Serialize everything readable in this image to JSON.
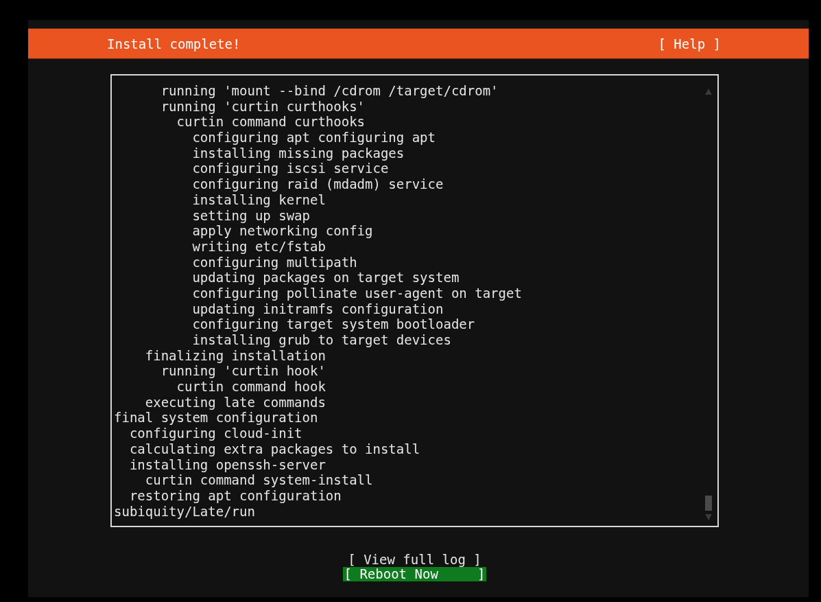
{
  "header": {
    "title": "Install complete!",
    "help": "[ Help ]"
  },
  "log": {
    "lines": [
      "      running 'mount --bind /cdrom /target/cdrom'",
      "      running 'curtin curthooks'",
      "        curtin command curthooks",
      "          configuring apt configuring apt",
      "          installing missing packages",
      "          configuring iscsi service",
      "          configuring raid (mdadm) service",
      "          installing kernel",
      "          setting up swap",
      "          apply networking config",
      "          writing etc/fstab",
      "          configuring multipath",
      "          updating packages on target system",
      "          configuring pollinate user-agent on target",
      "          updating initramfs configuration",
      "          configuring target system bootloader",
      "          installing grub to target devices",
      "    finalizing installation",
      "      running 'curtin hook'",
      "        curtin command hook",
      "    executing late commands",
      "final system configuration",
      "  configuring cloud-init",
      "  calculating extra packages to install",
      "  installing openssh-server",
      "    curtin command system-install",
      "  restoring apt configuration",
      "subiquity/Late/run"
    ]
  },
  "buttons": [
    {
      "label": "[ View full log ]",
      "selected": false
    },
    {
      "label": "[ Reboot Now     ]",
      "selected": true
    }
  ]
}
